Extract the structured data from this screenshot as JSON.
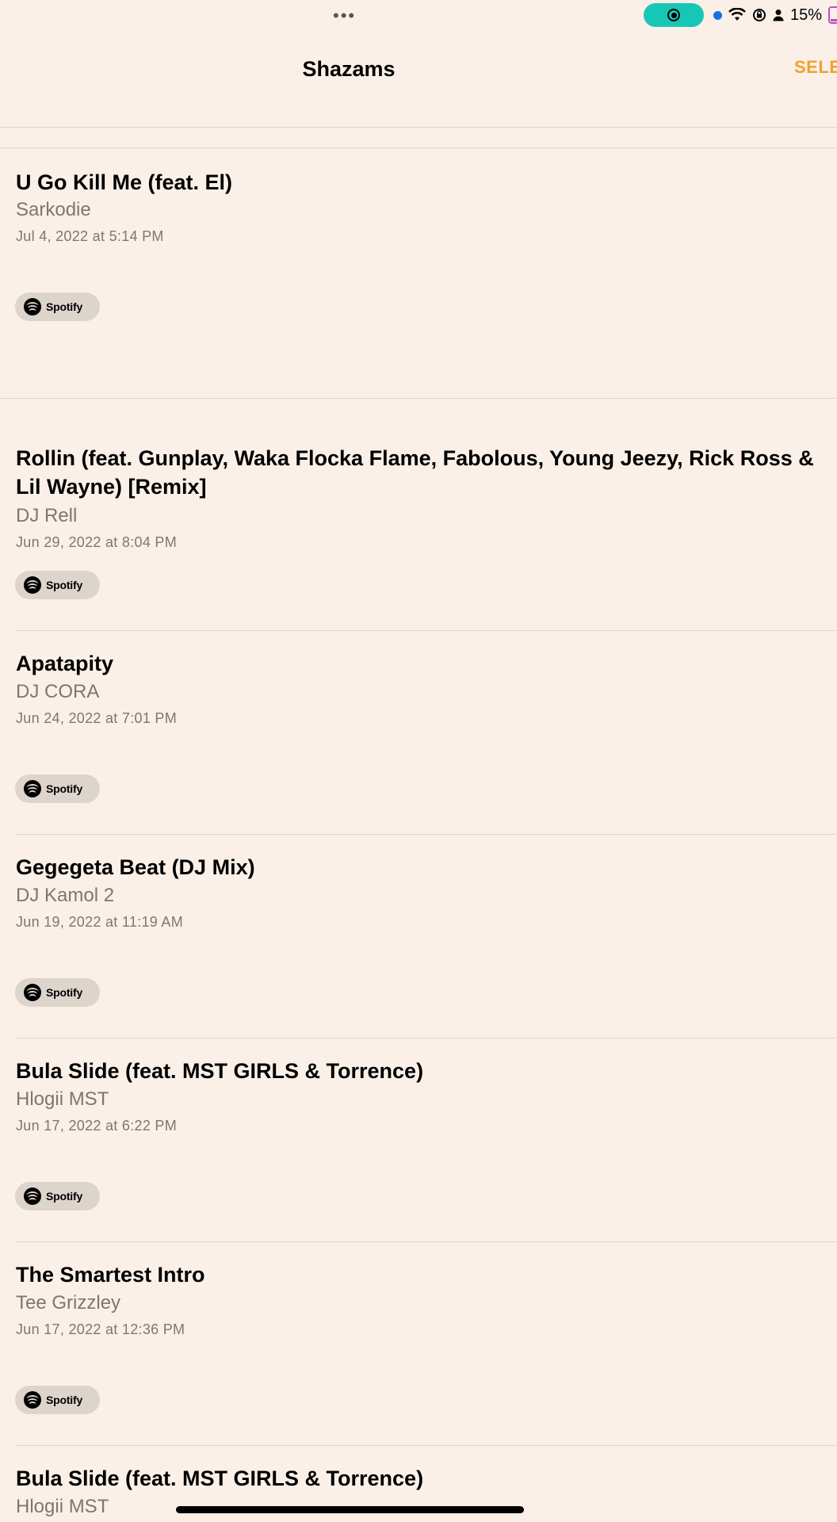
{
  "status_bar": {
    "dots": "•••",
    "battery_text": "15%"
  },
  "nav": {
    "title": "Shazams",
    "select_label": "SELECT"
  },
  "shazams": [
    {
      "title": "U Go Kill Me (feat. El)",
      "artist": "Sarkodie",
      "date": "Jul 4, 2022 at 5:14 PM",
      "service": "Spotify"
    },
    {
      "title": "Rollin (feat. Gunplay, Waka Flocka Flame, Fabolous, Young Jeezy, Rick Ross & Lil Wayne) [Remix]",
      "artist": "DJ Rell",
      "date": "Jun 29, 2022 at 8:04 PM",
      "service": "Spotify"
    },
    {
      "title": "Apatapity",
      "artist": "DJ CORA",
      "date": "Jun 24, 2022 at 7:01 PM",
      "service": "Spotify"
    },
    {
      "title": "Gegegeta Beat (DJ Mix)",
      "artist": "DJ Kamol 2",
      "date": "Jun 19, 2022 at 11:19 AM",
      "service": "Spotify"
    },
    {
      "title": "Bula Slide (feat. MST GIRLS & Torrence)",
      "artist": "Hlogii MST",
      "date": "Jun 17, 2022 at 6:22 PM",
      "service": "Spotify"
    },
    {
      "title": "The Smartest Intro",
      "artist": "Tee Grizzley",
      "date": "Jun 17, 2022 at 12:36 PM",
      "service": "Spotify"
    },
    {
      "title": "Bula Slide (feat. MST GIRLS & Torrence)",
      "artist": "Hlogii MST",
      "date": "",
      "service": ""
    }
  ],
  "colors": {
    "background": "#faf0e8",
    "accent": "#f0a030",
    "record_pill": "#17c7b6",
    "secondary_text": "#7d7672"
  }
}
